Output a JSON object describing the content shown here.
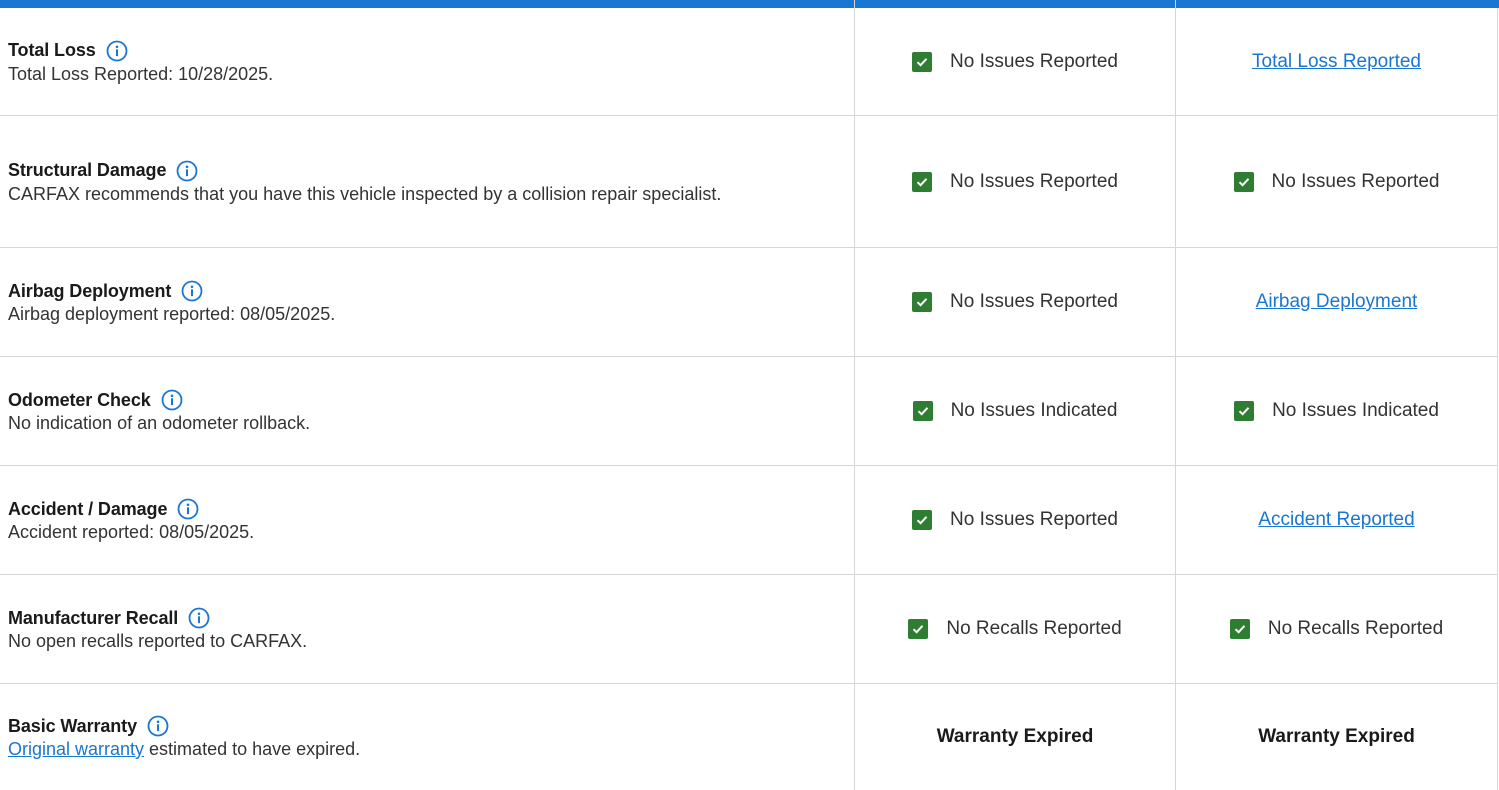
{
  "colors": {
    "accent": "#1976d2",
    "check_green": "#2e7d32",
    "divider": "#d6d6d6"
  },
  "rows": [
    {
      "title": "Total Loss",
      "desc": "Total Loss Reported: 10/28/2025.",
      "col1": {
        "type": "check",
        "text": "No Issues Reported"
      },
      "col2": {
        "type": "link",
        "text": "Total Loss Reported"
      }
    },
    {
      "title": "Structural Damage",
      "desc": "CARFAX recommends that you have this vehicle inspected by a collision repair specialist.",
      "col1": {
        "type": "check",
        "text": "No Issues Reported"
      },
      "col2": {
        "type": "check",
        "text": "No Issues Reported"
      }
    },
    {
      "title": "Airbag Deployment",
      "desc": "Airbag deployment reported: 08/05/2025.",
      "col1": {
        "type": "check",
        "text": "No Issues Reported"
      },
      "col2": {
        "type": "link",
        "text": "Airbag Deployment"
      }
    },
    {
      "title": "Odometer Check",
      "desc": "No indication of an odometer rollback.",
      "col1": {
        "type": "check",
        "text": "No Issues Indicated"
      },
      "col2": {
        "type": "check",
        "text": "No Issues Indicated"
      }
    },
    {
      "title": "Accident / Damage",
      "desc": "Accident reported: 08/05/2025.",
      "col1": {
        "type": "check",
        "text": "No Issues Reported"
      },
      "col2": {
        "type": "link",
        "text": "Accident Reported"
      }
    },
    {
      "title": "Manufacturer Recall",
      "desc": "No open recalls reported to CARFAX.",
      "col1": {
        "type": "check",
        "text": "No Recalls Reported"
      },
      "col2": {
        "type": "check",
        "text": "No Recalls Reported"
      }
    },
    {
      "title": "Basic Warranty",
      "desc_link": "Original warranty",
      "desc": " estimated to have expired.",
      "col1": {
        "type": "bold",
        "text": "Warranty Expired"
      },
      "col2": {
        "type": "bold",
        "text": "Warranty Expired"
      }
    }
  ]
}
